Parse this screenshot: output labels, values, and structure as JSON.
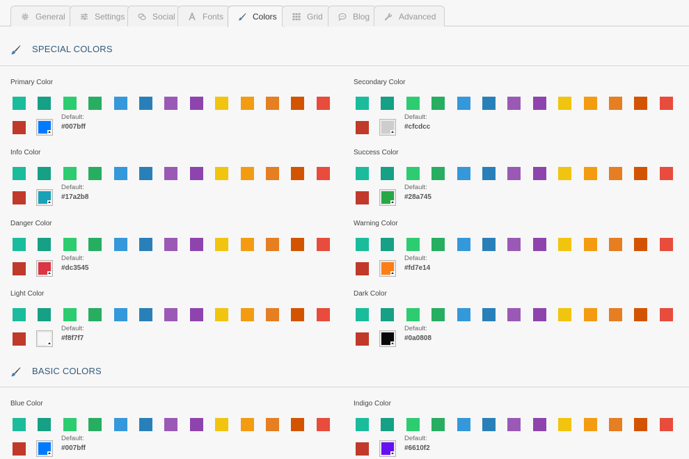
{
  "tabs": [
    {
      "label": "General",
      "icon": "gear-icon"
    },
    {
      "label": "Settings",
      "icon": "sliders-icon"
    },
    {
      "label": "Social",
      "icon": "chat-icon"
    },
    {
      "label": "Fonts",
      "icon": "font-icon"
    },
    {
      "label": "Colors",
      "icon": "brush-icon",
      "active": true
    },
    {
      "label": "Grid",
      "icon": "grid-icon"
    },
    {
      "label": "Blog",
      "icon": "comment-icon"
    },
    {
      "label": "Advanced",
      "icon": "wrench-icon"
    }
  ],
  "sections": [
    {
      "title": "SPECIAL COLORS",
      "icon": "brush-icon"
    },
    {
      "title": "BASIC COLORS",
      "icon": "brush-icon"
    }
  ],
  "palette": [
    "#1abc9c",
    "#16a085",
    "#2ecc71",
    "#27ae60",
    "#3498db",
    "#2980b9",
    "#9b59b6",
    "#8e44ad",
    "#f1c40f",
    "#f39c12",
    "#e67e22",
    "#d35400",
    "#e74c3c",
    "#c0392b"
  ],
  "default_label": "Default:",
  "fields": [
    {
      "label": "Primary Color",
      "value": "#007bff",
      "default": "#007bff"
    },
    {
      "label": "Secondary Color",
      "value": "#cfcdcc",
      "default": "#cfcdcc"
    },
    {
      "label": "Info Color",
      "value": "#17a2b8",
      "default": "#17a2b8"
    },
    {
      "label": "Success Color",
      "value": "#28a745",
      "default": "#28a745"
    },
    {
      "label": "Danger Color",
      "value": "#dc3545",
      "default": "#dc3545"
    },
    {
      "label": "Warning Color",
      "value": "#fd7e14",
      "default": "#fd7e14"
    },
    {
      "label": "Light Color",
      "value": "#f8f7f7",
      "default": "#f8f7f7"
    },
    {
      "label": "Dark Color",
      "value": "#0a0808",
      "default": "#0a0808"
    },
    {
      "label": "Blue Color",
      "value": "#007bff",
      "default": "#007bff"
    },
    {
      "label": "Indigo Color",
      "value": "#6610f2",
      "default": "#6610f2"
    }
  ]
}
